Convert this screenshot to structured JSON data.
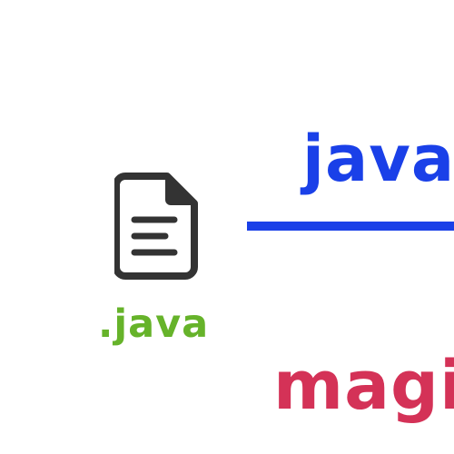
{
  "file": {
    "icon": "document-icon",
    "extension": ".java"
  },
  "heading": {
    "text": "java"
  },
  "subheading": {
    "text": "magi"
  },
  "colors": {
    "icon": "#333333",
    "extension": "#66b32a",
    "heading": "#1a40e8",
    "rule": "#1a40e8",
    "subheading": "#d43257"
  }
}
